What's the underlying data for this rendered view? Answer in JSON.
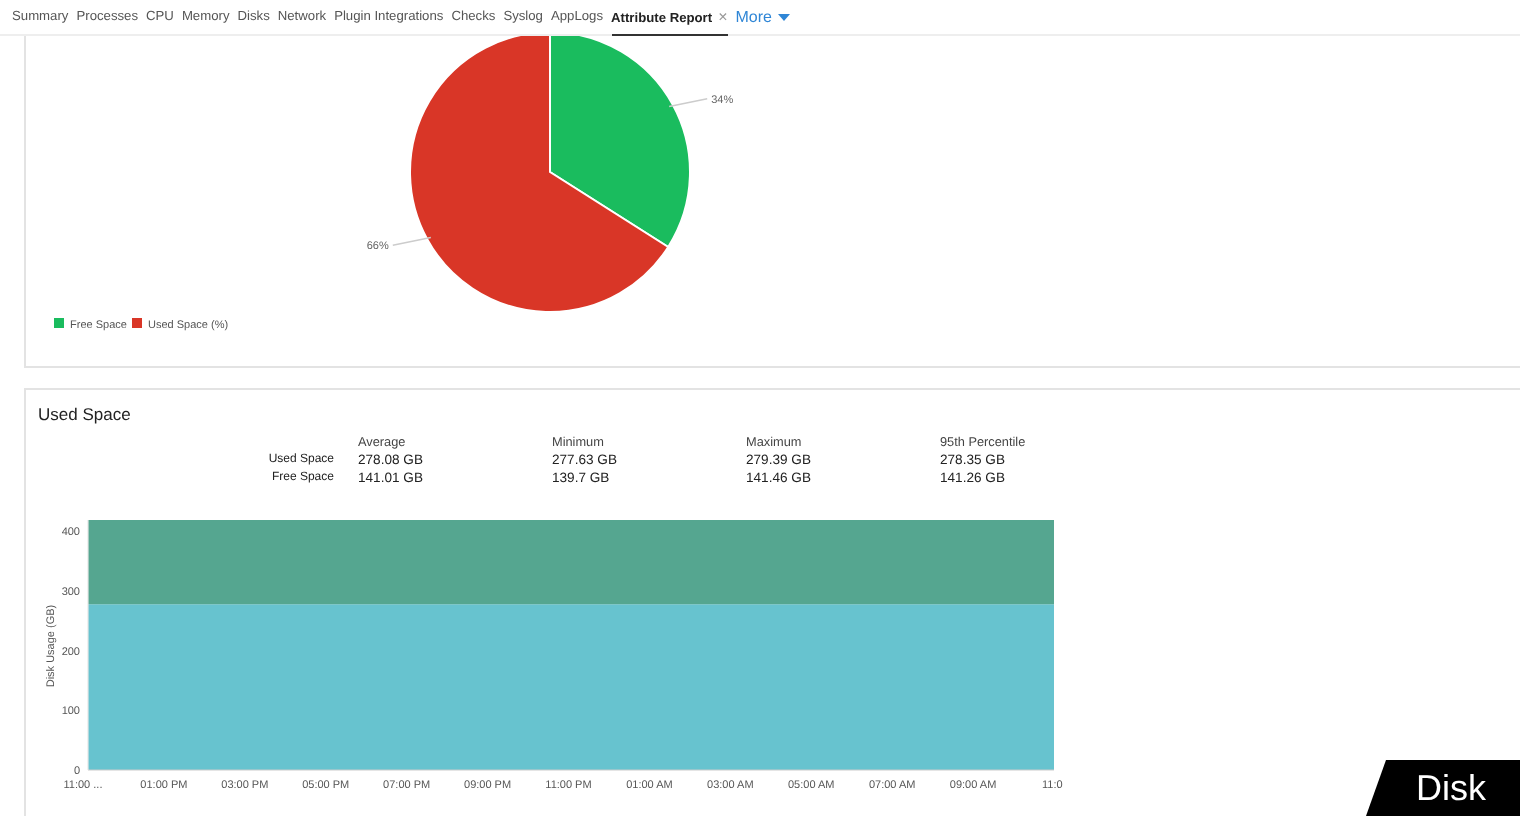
{
  "tabs": [
    {
      "label": "Summary",
      "selected": false
    },
    {
      "label": "Processes",
      "selected": false
    },
    {
      "label": "CPU",
      "selected": false
    },
    {
      "label": "Memory",
      "selected": false
    },
    {
      "label": "Disks",
      "selected": false
    },
    {
      "label": "Network",
      "selected": false
    },
    {
      "label": "Plugin Integrations",
      "selected": false
    },
    {
      "label": "Checks",
      "selected": false
    },
    {
      "label": "Syslog",
      "selected": false
    },
    {
      "label": "AppLogs",
      "selected": false
    },
    {
      "label": "Attribute Report",
      "selected": true,
      "close": "×"
    }
  ],
  "more_menu": {
    "label": "More"
  },
  "pie_panel": {
    "chart_data": {
      "type": "pie",
      "categories": [
        "Free Space",
        "Used Space (%)"
      ],
      "series": [
        {
          "values": [
            34,
            66
          ]
        }
      ],
      "colors": [
        "#1abc5e",
        "#d93627"
      ],
      "value_labels": [
        "34%",
        "66%"
      ],
      "legend": true
    }
  },
  "used_space_panel": {
    "title": "Used Space",
    "stats": {
      "columns": [
        "Average",
        "Minimum",
        "Maximum",
        "95th Percentile"
      ],
      "rows": [
        {
          "label": "Used Space",
          "values": [
            "278.08 GB",
            "277.63 GB",
            "279.39 GB",
            "278.35 GB"
          ]
        },
        {
          "label": "Free Space",
          "values": [
            "141.01 GB",
            "139.7 GB",
            "141.46 GB",
            "141.26 GB"
          ]
        }
      ]
    },
    "chart_data": {
      "type": "area",
      "stacked": true,
      "ylabel": "Disk Usage (GB)",
      "x": [
        "11:00 ...",
        "01:00 PM",
        "03:00 PM",
        "05:00 PM",
        "07:00 PM",
        "09:00 PM",
        "11:00 PM",
        "01:00 AM",
        "03:00 AM",
        "05:00 AM",
        "07:00 AM",
        "09:00 AM",
        "11:0"
      ],
      "series": [
        {
          "color": "#67c3cf",
          "values": [
            278,
            278,
            278,
            278,
            278,
            278,
            278,
            278,
            278,
            278,
            278,
            278,
            278
          ]
        },
        {
          "color": "#55a690",
          "values": [
            141,
            141,
            141,
            141,
            141,
            141,
            141,
            141,
            141,
            141,
            141,
            141,
            141
          ]
        }
      ],
      "ylim": [
        0,
        419
      ],
      "yticks": [
        0,
        100,
        200,
        300,
        400
      ]
    }
  },
  "caption": "Disk"
}
